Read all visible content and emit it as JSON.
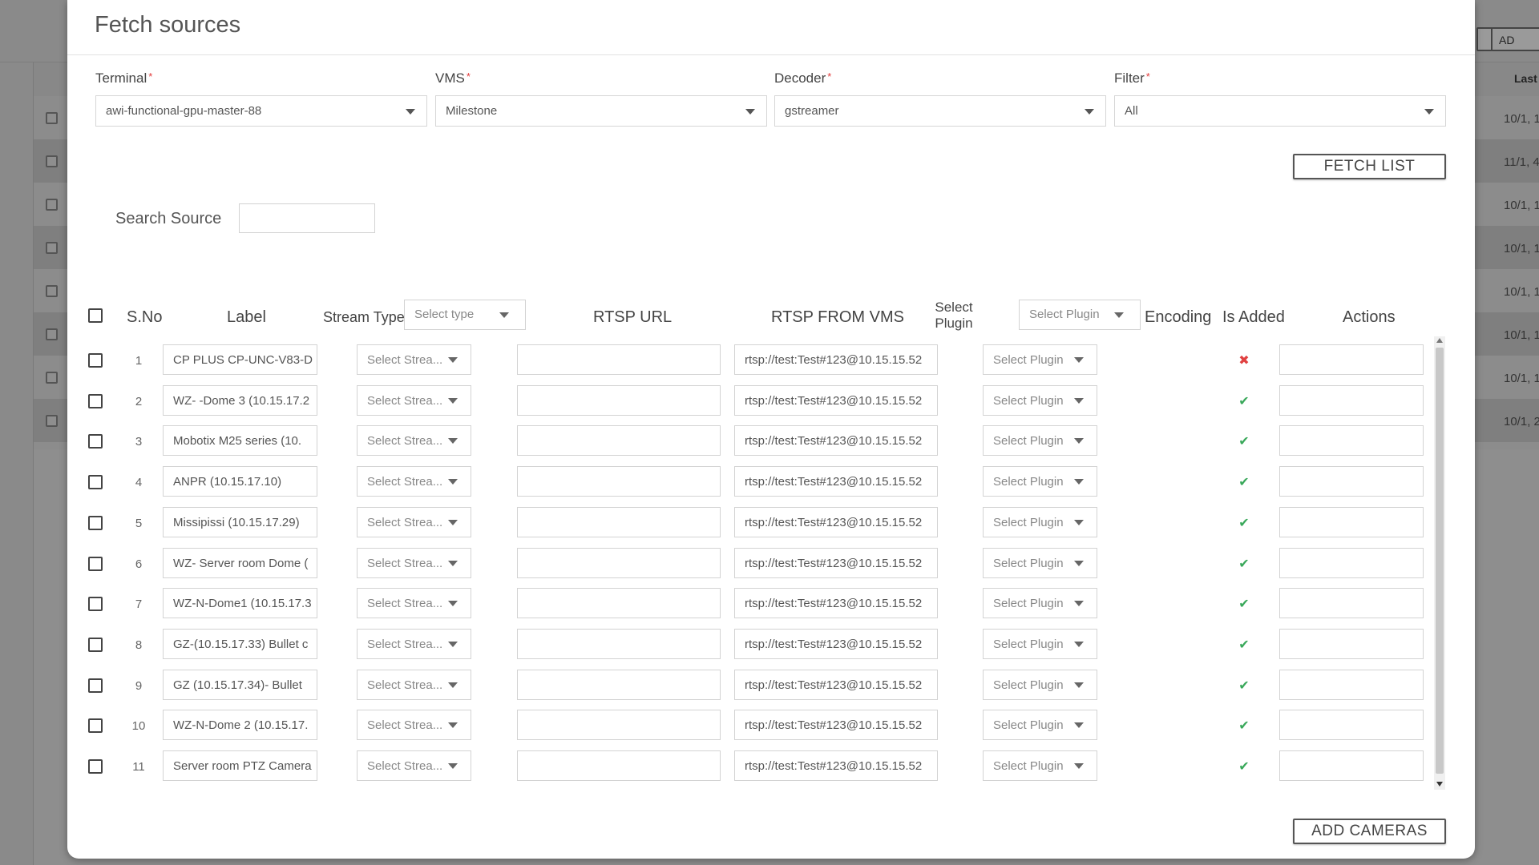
{
  "background": {
    "buttons": [
      "AD"
    ],
    "column_header": "Last",
    "dates": [
      "10/1, 1",
      "11/1, 4",
      "10/1, 1",
      "10/1, 1",
      "10/1, 1",
      "10/1, 1",
      "10/1, 1",
      "10/1, 2"
    ]
  },
  "modal": {
    "title": "Fetch sources",
    "fields": {
      "terminal": {
        "label": "Terminal",
        "value": "awi-functional-gpu-master-88"
      },
      "vms": {
        "label": "VMS",
        "value": "Milestone"
      },
      "decoder": {
        "label": "Decoder",
        "value": "gstreamer"
      },
      "filter": {
        "label": "Filter",
        "value": "All"
      }
    },
    "required_mark": "*",
    "fetch_button": "FETCH LIST",
    "search_label": "Search Source",
    "add_button": "ADD CAMERAS"
  },
  "table": {
    "headers": {
      "sno": "S.No",
      "label": "Label",
      "stream_type": "Stream Type",
      "stream_type_select": "Select type",
      "rtsp_url": "RTSP URL",
      "rtsp_from_vms": "RTSP FROM VMS",
      "select_plugin": "Select Plugin",
      "plugin_select": "Select Plugin",
      "encoding": "Encoding",
      "is_added": "Is Added",
      "actions": "Actions"
    },
    "rows": [
      {
        "sno": "1",
        "label": "CP PLUS CP-UNC-V83-D",
        "stream": "Select Strea...",
        "rtsp_url": "",
        "rtsp_vms": "rtsp://test:Test#123@10.15.15.52",
        "plugin": "Select Plugin",
        "added": "✖",
        "added_ok": false
      },
      {
        "sno": "2",
        "label": "WZ- -Dome 3 (10.15.17.2",
        "stream": "Select Strea...",
        "rtsp_url": "",
        "rtsp_vms": "rtsp://test:Test#123@10.15.15.52",
        "plugin": "Select Plugin",
        "added": "✔",
        "added_ok": true
      },
      {
        "sno": "3",
        "label": "Mobotix M25 series (10.",
        "stream": "Select Strea...",
        "rtsp_url": "",
        "rtsp_vms": "rtsp://test:Test#123@10.15.15.52",
        "plugin": "Select Plugin",
        "added": "✔",
        "added_ok": true
      },
      {
        "sno": "4",
        "label": "ANPR (10.15.17.10)",
        "stream": "Select Strea...",
        "rtsp_url": "",
        "rtsp_vms": "rtsp://test:Test#123@10.15.15.52",
        "plugin": "Select Plugin",
        "added": "✔",
        "added_ok": true
      },
      {
        "sno": "5",
        "label": "Missipissi (10.15.17.29)",
        "stream": "Select Strea...",
        "rtsp_url": "",
        "rtsp_vms": "rtsp://test:Test#123@10.15.15.52",
        "plugin": "Select Plugin",
        "added": "✔",
        "added_ok": true
      },
      {
        "sno": "6",
        "label": "WZ- Server room Dome (",
        "stream": "Select Strea...",
        "rtsp_url": "",
        "rtsp_vms": "rtsp://test:Test#123@10.15.15.52",
        "plugin": "Select Plugin",
        "added": "✔",
        "added_ok": true
      },
      {
        "sno": "7",
        "label": "WZ-N-Dome1 (10.15.17.3",
        "stream": "Select Strea...",
        "rtsp_url": "",
        "rtsp_vms": "rtsp://test:Test#123@10.15.15.52",
        "plugin": "Select Plugin",
        "added": "✔",
        "added_ok": true
      },
      {
        "sno": "8",
        "label": "GZ-(10.15.17.33) Bullet c",
        "stream": "Select Strea...",
        "rtsp_url": "",
        "rtsp_vms": "rtsp://test:Test#123@10.15.15.52",
        "plugin": "Select Plugin",
        "added": "✔",
        "added_ok": true
      },
      {
        "sno": "9",
        "label": "GZ (10.15.17.34)- Bullet",
        "stream": "Select Strea...",
        "rtsp_url": "",
        "rtsp_vms": "rtsp://test:Test#123@10.15.15.52",
        "plugin": "Select Plugin",
        "added": "✔",
        "added_ok": true
      },
      {
        "sno": "10",
        "label": "WZ-N-Dome 2 (10.15.17.",
        "stream": "Select Strea...",
        "rtsp_url": "",
        "rtsp_vms": "rtsp://test:Test#123@10.15.15.52",
        "plugin": "Select Plugin",
        "added": "✔",
        "added_ok": true
      },
      {
        "sno": "11",
        "label": "Server room PTZ Camera",
        "stream": "Select Strea...",
        "rtsp_url": "",
        "rtsp_vms": "rtsp://test:Test#123@10.15.15.52",
        "plugin": "Select Plugin",
        "added": "✔",
        "added_ok": true
      }
    ]
  },
  "colors": {
    "required": "#e23b3b",
    "added_ok": "#39a85a",
    "added_no": "#e04040"
  }
}
